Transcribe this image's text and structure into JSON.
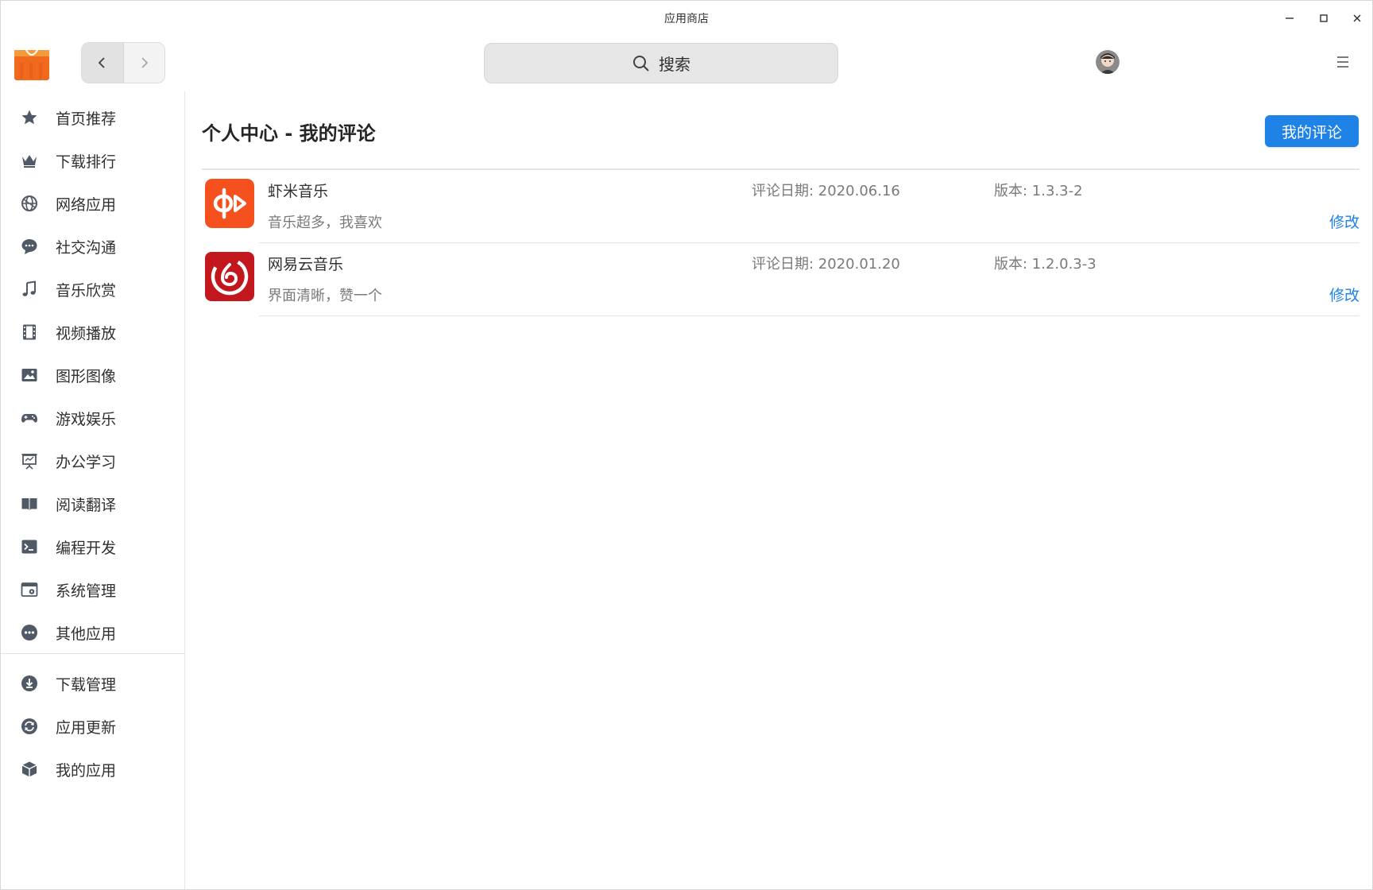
{
  "window": {
    "title": "应用商店"
  },
  "search": {
    "placeholder": "搜索"
  },
  "sidebar": {
    "items": [
      {
        "label": "首页推荐",
        "icon": "star-icon"
      },
      {
        "label": "下载排行",
        "icon": "crown-icon"
      },
      {
        "label": "网络应用",
        "icon": "globe-icon"
      },
      {
        "label": "社交沟通",
        "icon": "chat-icon"
      },
      {
        "label": "音乐欣赏",
        "icon": "music-note-icon"
      },
      {
        "label": "视频播放",
        "icon": "film-icon"
      },
      {
        "label": "图形图像",
        "icon": "image-icon"
      },
      {
        "label": "游戏娱乐",
        "icon": "gamepad-icon"
      },
      {
        "label": "办公学习",
        "icon": "presentation-icon"
      },
      {
        "label": "阅读翻译",
        "icon": "book-icon"
      },
      {
        "label": "编程开发",
        "icon": "terminal-icon"
      },
      {
        "label": "系统管理",
        "icon": "system-settings-icon"
      },
      {
        "label": "其他应用",
        "icon": "more-icon"
      }
    ],
    "bottom_items": [
      {
        "label": "下载管理",
        "icon": "download-icon"
      },
      {
        "label": "应用更新",
        "icon": "refresh-icon"
      },
      {
        "label": "我的应用",
        "icon": "package-icon"
      }
    ]
  },
  "main": {
    "title": "个人中心 - 我的评论",
    "my_reviews_button": "我的评论",
    "reviews": [
      {
        "app_name": "虾米音乐",
        "comment": "音乐超多，我喜欢",
        "date": "评论日期:  2020.06.16",
        "version": "版本:  1.3.3-2",
        "edit_label": "修改",
        "icon": "xiami-music-icon"
      },
      {
        "app_name": "网易云音乐",
        "comment": "界面清晰，赞一个",
        "date": "评论日期:  2020.01.20",
        "version": "版本:  1.2.0.3-3",
        "edit_label": "修改",
        "icon": "netease-music-icon"
      }
    ]
  },
  "colors": {
    "accent": "#1e82e6",
    "xiami": "#f4511e",
    "netease": "#c2181d",
    "text": "#303030",
    "muted": "#7a7a7a"
  }
}
